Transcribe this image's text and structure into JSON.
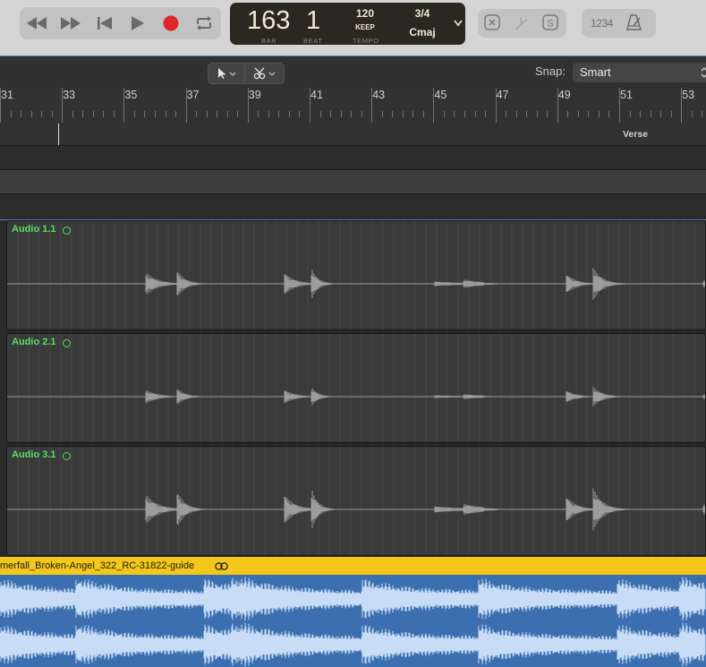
{
  "transport": {
    "bar": "163",
    "beat": "1",
    "bar_label": "BAR",
    "beat_label": "BEAT",
    "tempo": "120",
    "tempo_mode": "KEEP",
    "tempo_label": "TEMPO",
    "time_signature": "3/4",
    "key": "Cmaj",
    "count_in": "1234"
  },
  "toolbar": {
    "snap_label": "Snap:",
    "snap_value": "Smart"
  },
  "ruler": {
    "bars": [
      "31",
      "33",
      "35",
      "37",
      "39",
      "41",
      "43",
      "45",
      "47",
      "49",
      "51",
      "53"
    ]
  },
  "arrangement": {
    "marker": "Verse"
  },
  "tracks": [
    {
      "region": "Audio 1.1"
    },
    {
      "region": "Audio 2.1"
    },
    {
      "region": "Audio 3.1"
    }
  ],
  "guide": {
    "region": "merfall_Broken-Angel_322_RC-31822-guide"
  },
  "colors": {
    "region_label": "#55e06a",
    "guide_header": "#f3c81b",
    "guide_body": "#3b6fb0",
    "guide_wave": "#c8dcf6",
    "record": "#e0262b"
  }
}
